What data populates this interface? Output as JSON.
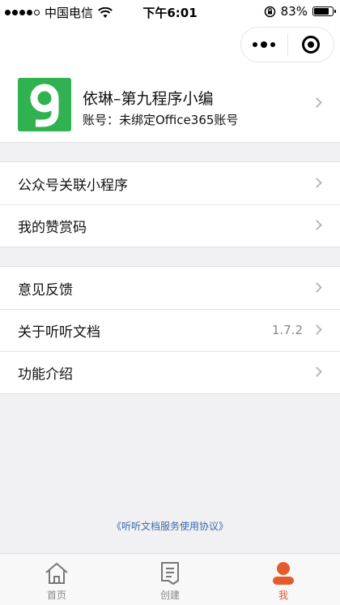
{
  "status_bar": {
    "carrier": "中国电信",
    "time": "下午6:01",
    "battery_percent": "83%",
    "battery_level": 0.83
  },
  "profile": {
    "name": "依琳–第九程序小编",
    "account": "账号：未绑定Office365账号"
  },
  "menu": {
    "group1": [
      {
        "label": "公众号关联小程序"
      },
      {
        "label": "我的赞赏码"
      }
    ],
    "group2": [
      {
        "label": "意见反馈"
      },
      {
        "label": "关于听听文档",
        "value": "1.7.2"
      },
      {
        "label": "功能介绍"
      }
    ]
  },
  "agreement": "《听听文档服务使用协议》",
  "tabbar": {
    "tabs": [
      {
        "label": "首页",
        "icon": "home-icon"
      },
      {
        "label": "创建",
        "icon": "document-icon"
      },
      {
        "label": "我",
        "icon": "user-icon",
        "active": true
      }
    ]
  },
  "colors": {
    "accent": "#e65a2c",
    "avatar_green": "#2fb24f",
    "link": "#3b6aa8"
  }
}
